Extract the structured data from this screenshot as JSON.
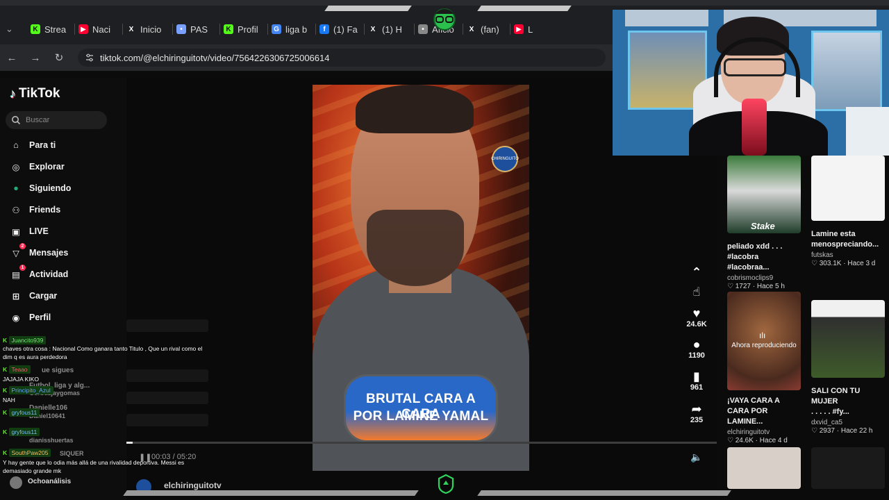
{
  "browser": {
    "tabs": [
      {
        "label": "Strea",
        "icon": "kick-icon",
        "color": "#53fc18"
      },
      {
        "label": "Naci",
        "icon": "youtube-icon",
        "color": "#ff0033"
      },
      {
        "label": "Inicio",
        "icon": "x-icon",
        "color": "#ffffff"
      },
      {
        "label": "PAS",
        "icon": "site-icon",
        "color": "#7aa0ff"
      },
      {
        "label": "Profil",
        "icon": "kick-icon",
        "color": "#53fc18"
      },
      {
        "label": "liga b",
        "icon": "google-icon",
        "color": "#4285f4"
      },
      {
        "label": "(1) Fa",
        "icon": "facebook-icon",
        "color": "#1877f2"
      },
      {
        "label": "(1) H",
        "icon": "x-icon",
        "color": "#ffffff"
      },
      {
        "label": "Aficio",
        "icon": "site-icon",
        "color": "#888888"
      },
      {
        "label": "(fan)",
        "icon": "x-icon",
        "color": "#ffffff"
      },
      {
        "label": "L",
        "icon": "youtube-icon",
        "color": "#ff0033"
      }
    ],
    "url": "tiktok.com/@elchiringuitotv/video/7564226306725006614"
  },
  "tiktok": {
    "brand": "TikTok",
    "search_placeholder": "Buscar",
    "nav": [
      {
        "label": "Para ti",
        "icon": "home-icon"
      },
      {
        "label": "Explorar",
        "icon": "compass-icon"
      },
      {
        "label": "Siguiendo",
        "icon": "following-icon"
      },
      {
        "label": "Friends",
        "icon": "friends-icon"
      },
      {
        "label": "LIVE",
        "icon": "live-icon"
      },
      {
        "label": "Mensajes",
        "icon": "messages-icon",
        "badge": "2"
      },
      {
        "label": "Actividad",
        "icon": "activity-icon",
        "badge": "1"
      },
      {
        "label": "Cargar",
        "icon": "upload-icon"
      },
      {
        "label": "Perfil",
        "icon": "profile-icon"
      }
    ],
    "following_faded": [
      "Futbol, liga y alg...",
      "Danielle106"
    ],
    "video": {
      "caption_line1": "BRUTAL CARA A CARA",
      "caption_line2": "POR LAMINE YAMAL",
      "badge_text": "CHIRINGUITO",
      "likes": "24.6K",
      "comments": "1190",
      "saves": "961",
      "shares": "235",
      "timecode": "00:03 / 05:20",
      "progress": 0.01,
      "author": "elchiringuitotv"
    },
    "related": [
      {
        "title": "peliado xdd . . .\n#lacobra #lacobraa...",
        "author": "cobrismoclips9",
        "likes": "1727",
        "age": "Hace 5 h"
      },
      {
        "title": "Lamine esta\nmenospreciando...",
        "author": "futskas",
        "likes": "303.1K",
        "age": "Hace 3 d"
      },
      {
        "title": "¡VAYA CARA A\nCARA POR LAMINE...",
        "author": "elchiringuitotv",
        "likes": "24.6K",
        "age": "Hace 4 d",
        "now_playing": "Ahora reproduciendo"
      },
      {
        "title": "SALI CON TU MUJER\n. . . . . #fy...",
        "author": "dxvid_ca5",
        "likes": "2937",
        "age": "Hace 22 h"
      }
    ],
    "thumb_overlay_text": "Stake"
  },
  "chat": [
    {
      "user": "Juancito939",
      "msg": "chaves otra cosa : Nacional Como ganara tanto Titulo , Que un rival como el dim q es aura perdedora"
    },
    {
      "user": "Teaao",
      "msg": "JAJAJA KIKO"
    },
    {
      "user": "Principito_Azul",
      "msg": "NAH"
    },
    {
      "user": "gryfous11",
      "msg": ""
    },
    {
      "user": "gryfous11",
      "msg": ""
    },
    {
      "user": "SouthPaw205",
      "msg": "Y hay gente que lo odia más allá de una rivalidad deportiva. Messi es demasiado grande mk"
    }
  ],
  "chat_faded": [
    "ue sigues",
    "Gurbuzjaygomas",
    "Daniel10641",
    "dianisshuertas",
    "SIQUER"
  ],
  "overlay_bottom_text": "Ochoanálisis"
}
